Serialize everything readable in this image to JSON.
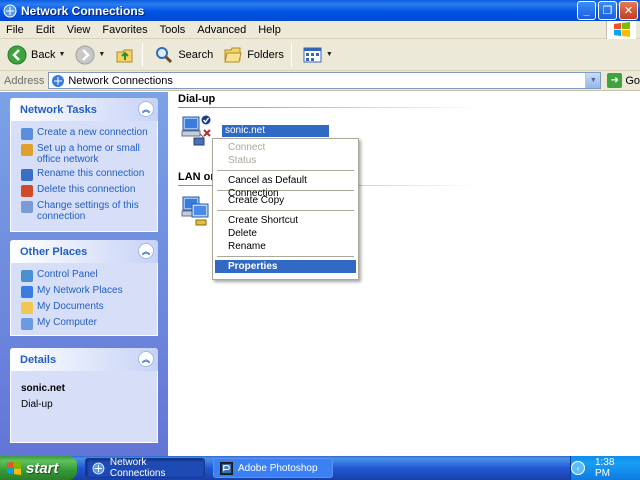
{
  "window": {
    "title": "Network Connections"
  },
  "menubar": {
    "items": [
      "File",
      "Edit",
      "View",
      "Favorites",
      "Tools",
      "Advanced",
      "Help"
    ]
  },
  "toolbar": {
    "back": "Back",
    "search": "Search",
    "folders": "Folders"
  },
  "address": {
    "label": "Address",
    "value": "Network Connections",
    "go": "Go"
  },
  "left": {
    "network_tasks": {
      "title": "Network Tasks",
      "items": [
        "Create a new connection",
        "Set up a home or small office network",
        "Rename this connection",
        "Delete this connection",
        "Change settings of this connection"
      ]
    },
    "other_places": {
      "title": "Other Places",
      "items": [
        "Control Panel",
        "My Network Places",
        "My Documents",
        "My Computer"
      ]
    },
    "details": {
      "title": "Details",
      "name": "sonic.net",
      "type": "Dial-up"
    }
  },
  "main": {
    "groups": [
      {
        "title": "Dial-up"
      },
      {
        "title": "LAN or I"
      }
    ],
    "selected_connection": "sonic.net"
  },
  "context_menu": {
    "items": [
      "Connect",
      "Status",
      "Cancel as Default Connection",
      "Create Copy",
      "Create Shortcut",
      "Delete",
      "Rename",
      "Properties"
    ]
  },
  "taskbar": {
    "start": "start",
    "tasks": [
      "Network Connections",
      "Adobe Photoshop"
    ],
    "clock": "1:38 PM"
  }
}
